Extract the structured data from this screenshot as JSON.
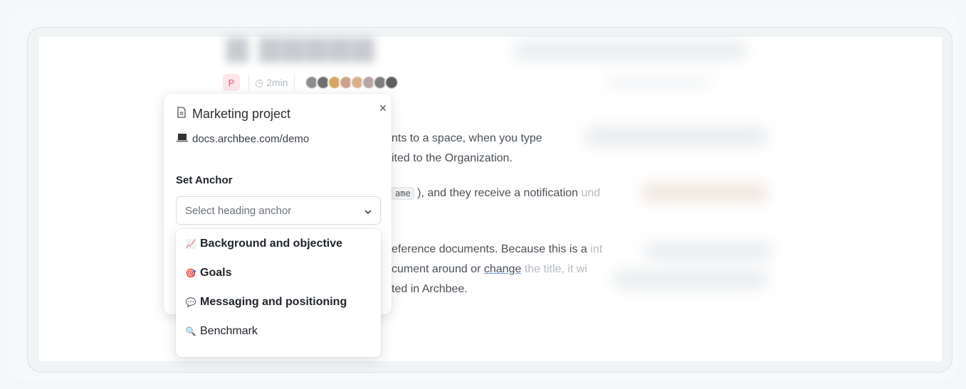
{
  "document": {
    "read_time": "2min",
    "badge_letter": "P",
    "lines": [
      {
        "text": "nts to a space, when you type",
        "fade": ""
      },
      {
        "text": "ited to the Organization.",
        "fade": ""
      },
      {
        "code": "ame",
        "text": "), and they receive a notification",
        "fade": "und"
      },
      {
        "text": "eference documents. Because this is a",
        "fade": "int"
      },
      {
        "text": "cument around or",
        "link": "change",
        "after": "the title,",
        "fade": "it wi"
      },
      {
        "text": "ted in Archbee.",
        "fade": ""
      }
    ]
  },
  "popover": {
    "title": "Marketing project",
    "url": "docs.archbee.com/demo",
    "close_label": "×",
    "anchor_label": "Set Anchor",
    "select_placeholder": "Select heading anchor",
    "options": [
      {
        "icon": "chart-icon",
        "emoji": "📈",
        "label": "Background and objective"
      },
      {
        "icon": "target-icon",
        "emoji": "🎯",
        "label": "Goals"
      },
      {
        "icon": "speech-bubble-icon",
        "emoji": "💬",
        "label": "Messaging and positioning"
      },
      {
        "icon": "magnifier-icon",
        "emoji": "🔍",
        "label": "Benchmark"
      }
    ]
  },
  "colors": {
    "badge_bg": "#fde6ea",
    "badge_fg": "#e45b74",
    "link_underline": "#6aa1e8"
  }
}
